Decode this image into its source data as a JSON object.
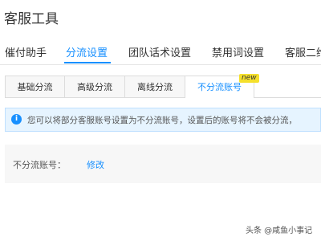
{
  "page_title": "客服工具",
  "nav": {
    "tabs": [
      {
        "label": "催付助手",
        "active": false
      },
      {
        "label": "分流设置",
        "active": true
      },
      {
        "label": "团队话术设置",
        "active": false
      },
      {
        "label": "禁用词设置",
        "active": false
      },
      {
        "label": "客服二维",
        "active": false
      }
    ]
  },
  "subtabs": {
    "tabs": [
      {
        "label": "基础分流",
        "active": false
      },
      {
        "label": "高级分流",
        "active": false
      },
      {
        "label": "离线分流",
        "active": false
      },
      {
        "label": "不分流账号",
        "active": true
      }
    ],
    "badge": "new"
  },
  "notice": {
    "icon": "info-icon",
    "text": "您可以将部分客服账号设置为不分流账号，设置后的账号将不会被分流，"
  },
  "panel": {
    "label": "不分流账号：",
    "link": "修改"
  },
  "watermark": "头条 @咸鱼小事记",
  "colors": {
    "accent": "#1890ff",
    "notice_bg": "#e6f4ff",
    "badge_bg": "#f5e02c"
  }
}
